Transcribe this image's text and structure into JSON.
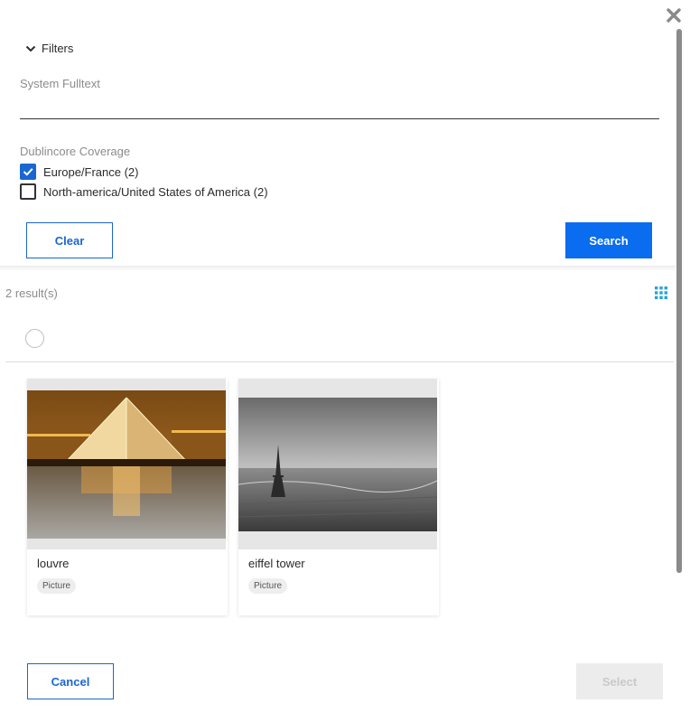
{
  "dialog": {
    "close_icon": "close-icon",
    "filters": {
      "toggle_label": "Filters",
      "toggle_icon": "chevron-down-icon",
      "fulltext": {
        "label": "System Fulltext",
        "value": "",
        "placeholder": ""
      },
      "coverage": {
        "label": "Dublincore Coverage",
        "options": [
          {
            "label": "Europe/France (2)",
            "checked": true
          },
          {
            "label": "North-america/United States of America (2)",
            "checked": false
          }
        ]
      },
      "clear_label": "Clear",
      "search_label": "Search"
    },
    "results": {
      "count_text": "2 result(s)",
      "view_icon": "grid-view-icon",
      "items": [
        {
          "title": "louvre",
          "type": "Picture"
        },
        {
          "title": "eiffel tower",
          "type": "Picture"
        }
      ]
    },
    "footer": {
      "cancel_label": "Cancel",
      "select_label": "Select"
    },
    "colors": {
      "accent": "#0a6cef",
      "checkbox_checked": "#1a66d2",
      "text": "#2b2b2b",
      "muted": "#8c8c8c",
      "grid_icon": "#29a3d6"
    }
  }
}
